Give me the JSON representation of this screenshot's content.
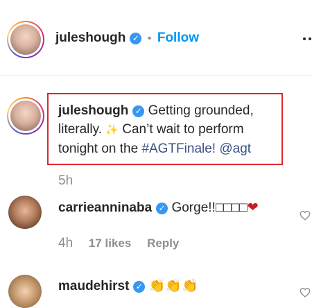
{
  "header": {
    "username": "juleshough",
    "separator": "•",
    "follow_label": "Follow",
    "more_icon": "ellipsis-icon"
  },
  "caption": {
    "username": "juleshough",
    "text_1": "Getting grounded,",
    "text_2": "literally.",
    "sparkle": "✨",
    "text_3": "Can’t wait to perform",
    "text_4": "tonight on the",
    "hashtag": "#AGTFinale!",
    "mention": "@agt",
    "time": "5h",
    "highlight_color": "#e0262c"
  },
  "comments": [
    {
      "username": "carrieanninaba",
      "text": "Gorge!!□□□□",
      "emoji": "❤",
      "time": "4h",
      "likes": "17 likes",
      "reply": "Reply"
    },
    {
      "username": "maudehirst",
      "emoji": "👏👏👏"
    }
  ],
  "colors": {
    "verified": "#3897f0",
    "follow": "#0095f6",
    "link": "#385185",
    "muted": "#8e8e8e"
  }
}
